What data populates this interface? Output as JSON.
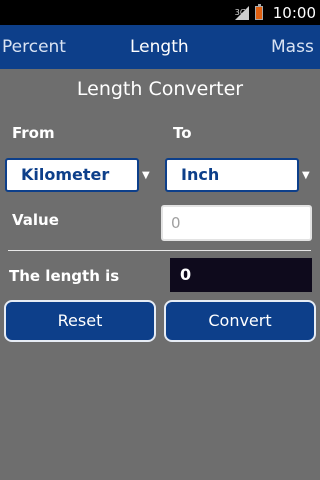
{
  "status": {
    "network": "3G",
    "time": "10:00"
  },
  "tabs": [
    "Percent",
    "Length",
    "Mass"
  ],
  "screen": {
    "title": "Length Converter",
    "from_label": "From",
    "to_label": "To",
    "from_unit": "Kilometer",
    "to_unit": "Inch",
    "value_label": "Value",
    "value_placeholder": "0",
    "result_label": "The length is",
    "result_value": "0",
    "reset_label": "Reset",
    "convert_label": "Convert"
  },
  "colors": {
    "tab_bar": "#0d3f8a",
    "background": "#6e6e6e",
    "button": "#0d3f8a",
    "result_box": "#0e0a1c",
    "battery": "#e06010"
  }
}
